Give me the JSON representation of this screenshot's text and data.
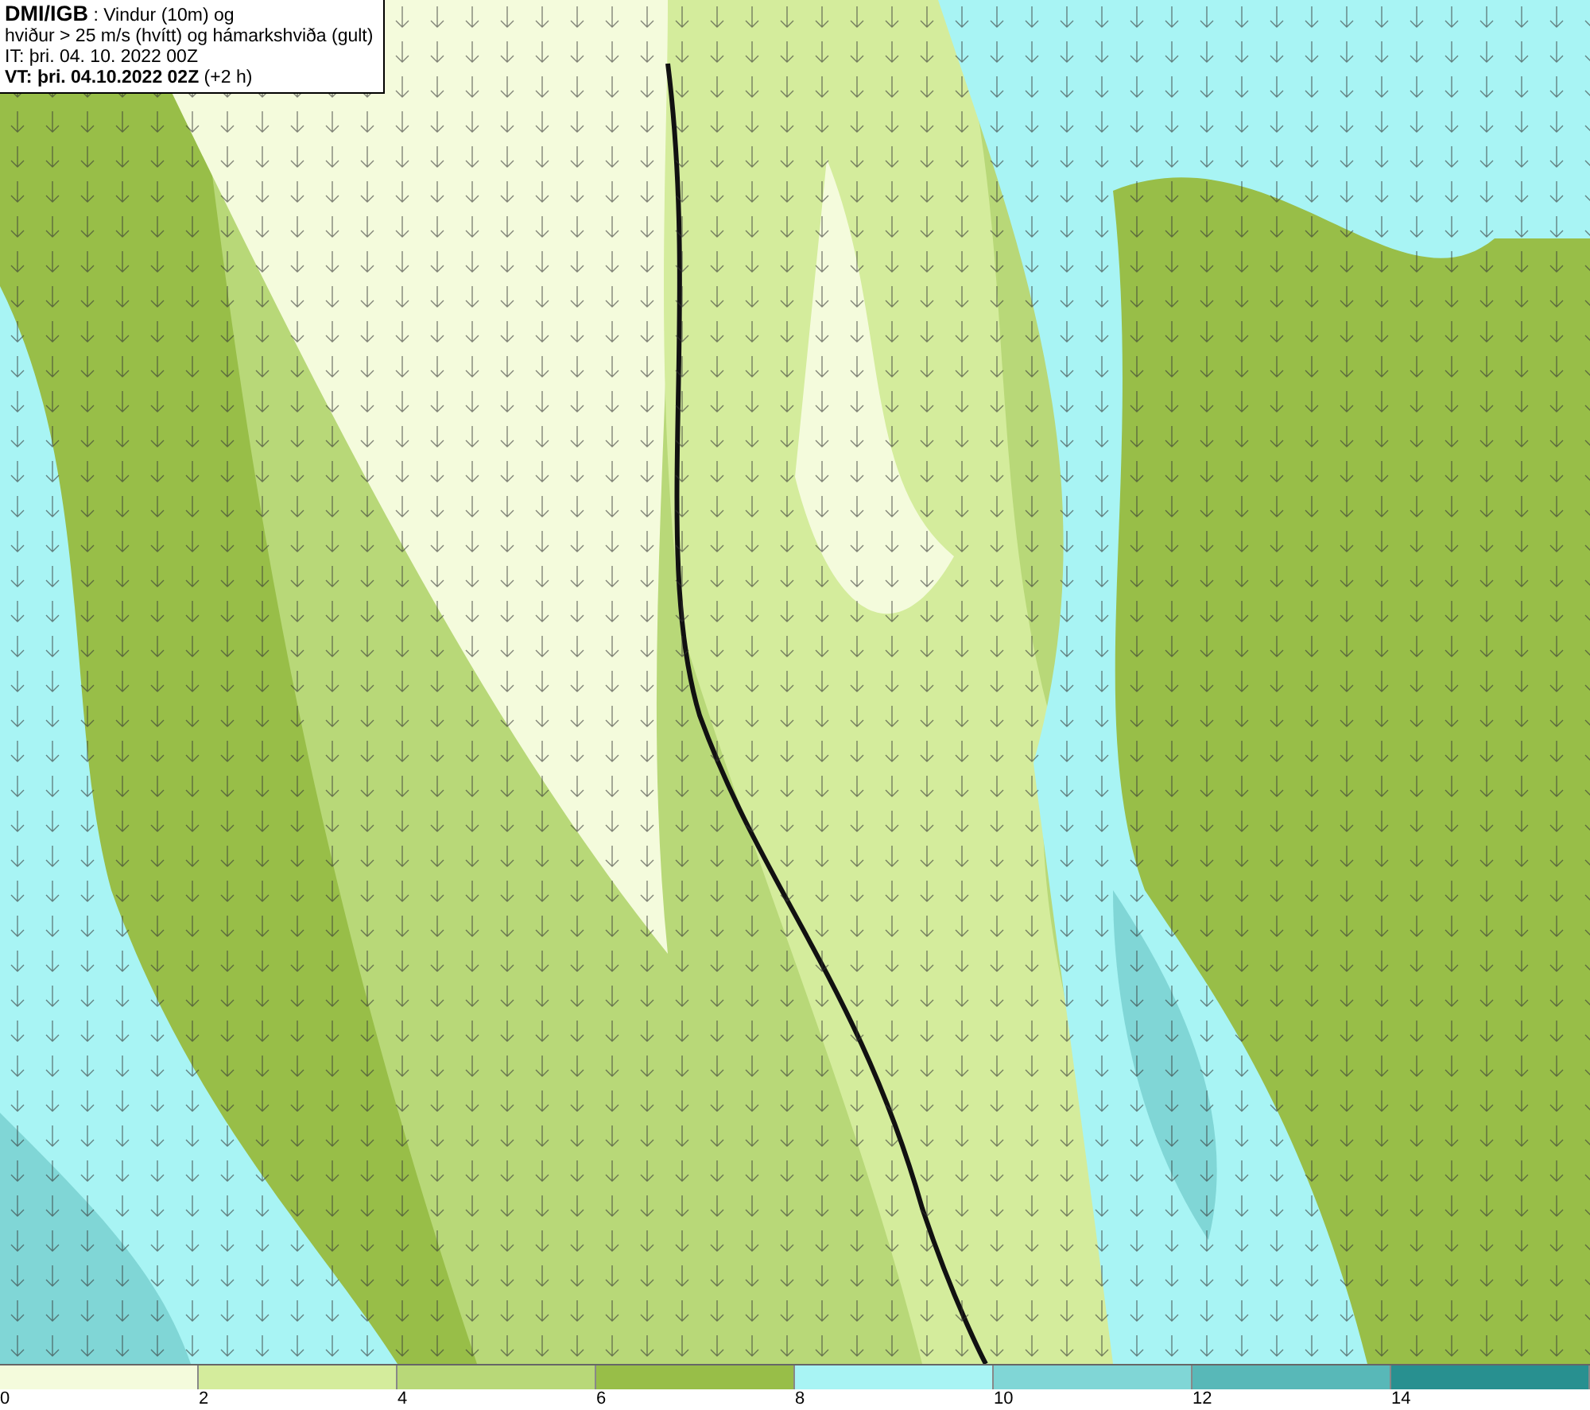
{
  "title_box": {
    "lines": [
      "**DMI/IGB** : Vindur (10m) og",
      "hviður > 25 m/s (hvítt) og hámarkshviða (gult)",
      "IT: þri. 04. 10. 2022 00Z",
      "**VT: þri. 04.10.2022 02Z** (+2 h)"
    ]
  },
  "legend": {
    "bins": [
      {
        "color": "#f4fbdc",
        "label": "0"
      },
      {
        "color": "#d4ec9c",
        "label": "2"
      },
      {
        "color": "#b8d878",
        "label": "4"
      },
      {
        "color": "#98be48",
        "label": "6"
      },
      {
        "color": "#a8f4f4",
        "label": "8"
      },
      {
        "color": "#80d6d6",
        "label": "10"
      },
      {
        "color": "#58b8b8",
        "label": "12"
      },
      {
        "color": "#289090",
        "label": "14"
      }
    ]
  }
}
